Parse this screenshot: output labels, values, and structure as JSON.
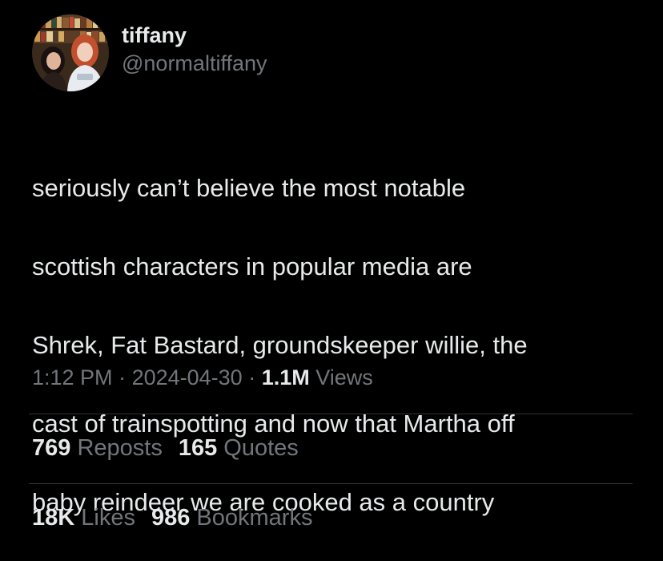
{
  "author": {
    "display_name": "tiffany",
    "handle": "@normaltiffany",
    "avatar_icon": "profile-photo-avatar"
  },
  "tweet": {
    "text_lines": [
      "seriously can’t believe the most notable",
      "scottish characters in popular media are",
      "Shrek, Fat Bastard, groundskeeper willie, the",
      "cast of trainspotting and now that Martha off",
      "baby reindeer we are cooked as a country"
    ]
  },
  "meta": {
    "time": "1:12 PM",
    "separator": " · ",
    "date": "2024-04-30",
    "views_count": "1.1M",
    "views_label": "Views"
  },
  "stats_row_1": {
    "reposts_count": "769",
    "reposts_label": "Reposts",
    "quotes_count": "165",
    "quotes_label": "Quotes"
  },
  "stats_row_2": {
    "likes_count": "18K",
    "likes_label": "Likes",
    "bookmarks_count": "986",
    "bookmarks_label": "Bookmarks"
  },
  "colors": {
    "background": "#000000",
    "primary_text": "#e7e9ea",
    "secondary_text": "#71767b",
    "divider": "#2f3336"
  }
}
